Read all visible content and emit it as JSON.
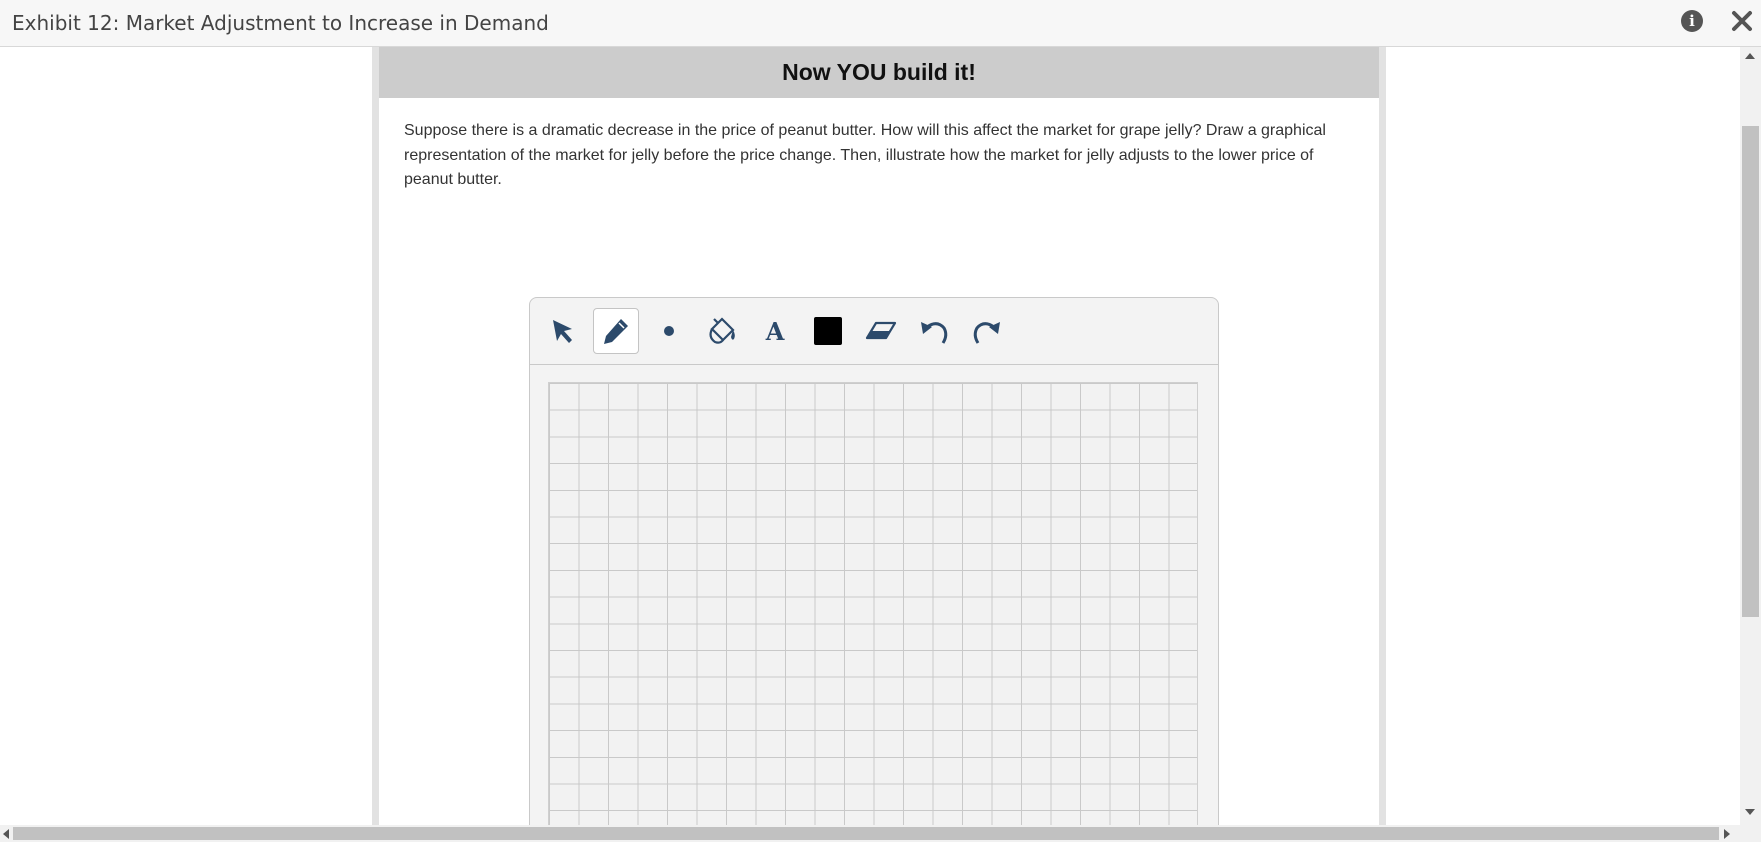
{
  "window": {
    "title": "Exhibit 12: Market Adjustment to Increase in Demand",
    "info_icon": "info-icon",
    "close_icon": "close-icon"
  },
  "panel": {
    "heading": "Now YOU build it!",
    "prompt": "Suppose there is a dramatic decrease in the price of peanut butter. How will this affect the market for grape jelly? Draw a graphical representation of the market for jelly before the price change. Then, illustrate how the market for jelly adjusts to the lower price of peanut butter."
  },
  "drawing_tool": {
    "tools": [
      {
        "name": "select",
        "icon": "arrow-pointer-icon",
        "active": false
      },
      {
        "name": "pencil",
        "icon": "pencil-icon",
        "active": true
      },
      {
        "name": "point",
        "icon": "dot-icon",
        "active": false
      },
      {
        "name": "fill",
        "icon": "paint-bucket-icon",
        "active": false
      },
      {
        "name": "text",
        "icon": "text-icon",
        "glyph": "A",
        "active": false
      },
      {
        "name": "color",
        "icon": "color-swatch-icon",
        "color": "#000000",
        "active": false
      },
      {
        "name": "eraser",
        "icon": "eraser-icon",
        "active": false
      },
      {
        "name": "undo",
        "icon": "undo-icon",
        "active": false
      },
      {
        "name": "redo",
        "icon": "redo-icon",
        "active": false
      }
    ],
    "icon_color": "#2c4a6b"
  }
}
